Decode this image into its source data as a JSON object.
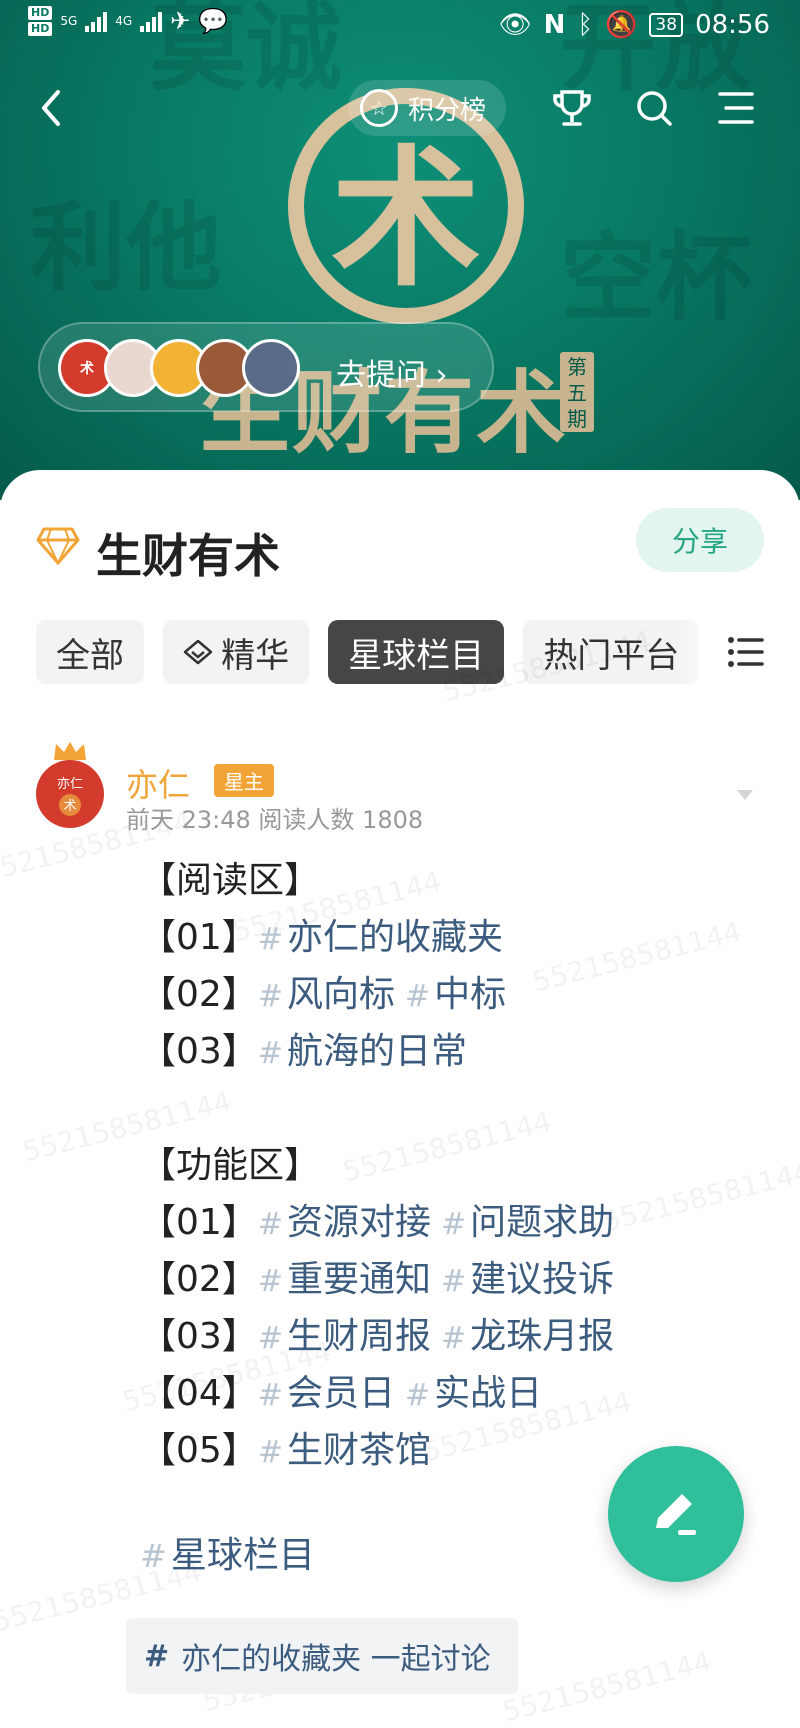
{
  "status_bar": {
    "time": "08:56",
    "battery": "38",
    "network_labels": [
      "HD",
      "HD",
      "5G",
      "4G"
    ]
  },
  "header": {
    "points_rank_label": "积分榜"
  },
  "banner": {
    "ask_label": "去提问 ›",
    "brand_title": "生财有术",
    "issue_badge": "第五期"
  },
  "group": {
    "title": "生财有术",
    "share_label": "分享"
  },
  "tabs": [
    {
      "label": "全部"
    },
    {
      "label": "精华"
    },
    {
      "label": "星球栏目",
      "active": true
    },
    {
      "label": "热门平台"
    }
  ],
  "post": {
    "author": "亦仁",
    "badge": "星主",
    "meta": "前天 23:48  阅读人数 1808",
    "sections": [
      {
        "heading": "【阅读区】",
        "rows": [
          {
            "num": "【01】",
            "tags": [
              "亦仁的收藏夹"
            ]
          },
          {
            "num": "【02】",
            "tags": [
              "风向标",
              "中标"
            ]
          },
          {
            "num": "【03】",
            "tags": [
              "航海的日常"
            ]
          }
        ]
      },
      {
        "heading": "【功能区】",
        "rows": [
          {
            "num": "【01】",
            "tags": [
              "资源对接",
              "问题求助"
            ]
          },
          {
            "num": "【02】",
            "tags": [
              "重要通知",
              "建议投诉"
            ]
          },
          {
            "num": "【03】",
            "tags": [
              "生财周报",
              "龙珠月报"
            ]
          },
          {
            "num": "【04】",
            "tags": [
              "会员日",
              "实战日"
            ]
          },
          {
            "num": "【05】",
            "tags": [
              "生财茶馆"
            ]
          }
        ]
      }
    ],
    "topic_tag": "星球栏目",
    "discuss_chip": "亦仁的收藏夹 一起讨论"
  },
  "watermark": "552158581144",
  "colors": {
    "banner_green": "#087a64",
    "accent_green": "#2fbf9b",
    "tag_blue": "#3c5c7f",
    "author_orange": "#f0a53a"
  }
}
